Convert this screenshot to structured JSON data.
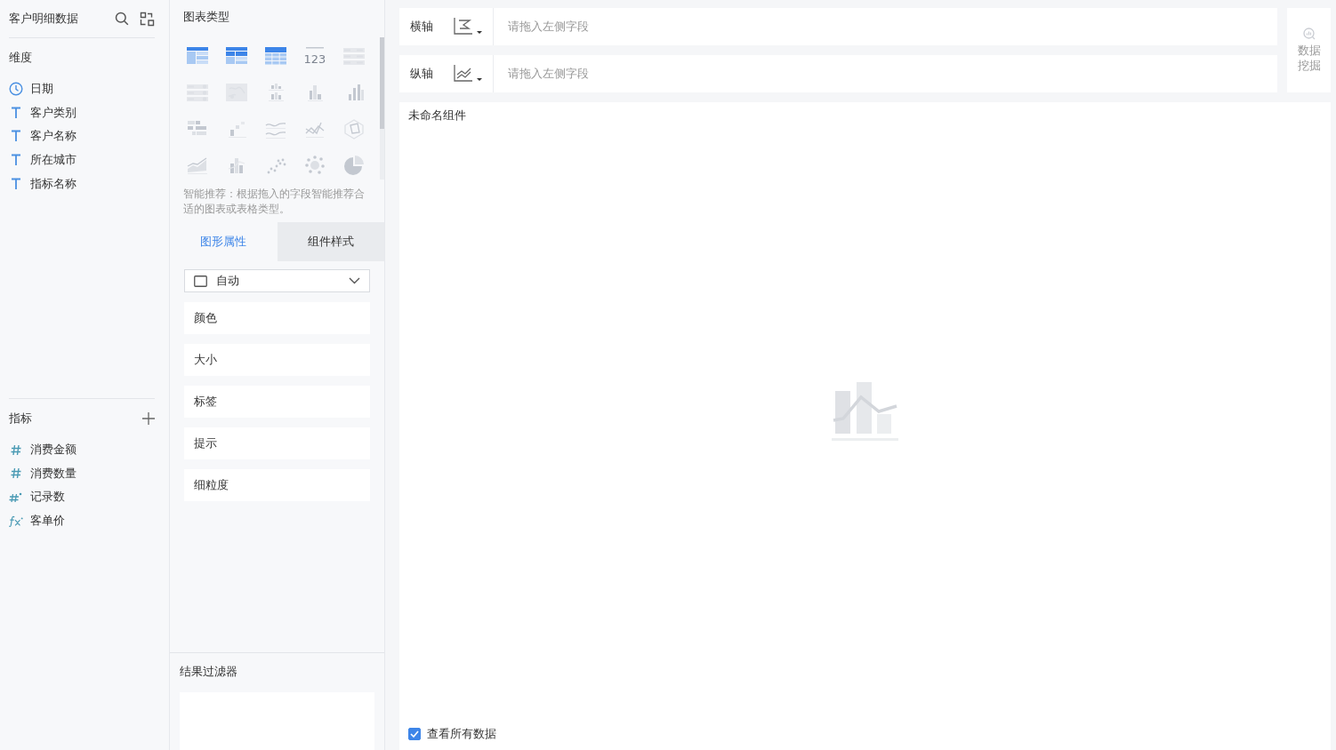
{
  "dataset": {
    "title": "客户明细数据"
  },
  "dimensions": {
    "title": "维度",
    "fields": [
      {
        "name": "日期",
        "kind": "date"
      },
      {
        "name": "客户类别",
        "kind": "text"
      },
      {
        "name": "客户名称",
        "kind": "text"
      },
      {
        "name": "所在城市",
        "kind": "text"
      },
      {
        "name": "指标名称",
        "kind": "text"
      }
    ]
  },
  "measures": {
    "title": "指标",
    "fields": [
      {
        "name": "消费金额",
        "kind": "number"
      },
      {
        "name": "消费数量",
        "kind": "number"
      },
      {
        "name": "记录数",
        "kind": "count"
      },
      {
        "name": "客单价",
        "kind": "formula"
      }
    ]
  },
  "chart_types": {
    "title": "图表类型",
    "items": [
      {
        "kind": "cross-table",
        "enabled": true
      },
      {
        "kind": "group-table",
        "enabled": true
      },
      {
        "kind": "detail-table",
        "enabled": true
      },
      {
        "kind": "number",
        "enabled": false,
        "label": "123"
      },
      {
        "kind": "kpi-list",
        "enabled": false
      },
      {
        "kind": "kpi-card",
        "enabled": false
      },
      {
        "kind": "map",
        "enabled": false
      },
      {
        "kind": "grouped-bar",
        "enabled": false
      },
      {
        "kind": "bar",
        "enabled": false
      },
      {
        "kind": "column",
        "enabled": false
      },
      {
        "kind": "horizontal-bar",
        "enabled": false
      },
      {
        "kind": "step",
        "enabled": false
      },
      {
        "kind": "multi-line",
        "enabled": false
      },
      {
        "kind": "line",
        "enabled": false
      },
      {
        "kind": "radar",
        "enabled": false
      },
      {
        "kind": "area",
        "enabled": false
      },
      {
        "kind": "bar-line",
        "enabled": false
      },
      {
        "kind": "scatter",
        "enabled": false
      },
      {
        "kind": "bubble",
        "enabled": false
      },
      {
        "kind": "pie",
        "enabled": false
      }
    ],
    "hint": "智能推荐：根据拖入的字段智能推荐合适的图表或表格类型。"
  },
  "property_tabs": [
    {
      "label": "图形属性",
      "selected": true
    },
    {
      "label": "组件样式",
      "selected": false
    }
  ],
  "mark_type": {
    "value": "自动"
  },
  "attributes": [
    "颜色",
    "大小",
    "标签",
    "提示",
    "细粒度"
  ],
  "result_filter": {
    "title": "结果过滤器"
  },
  "axes": [
    {
      "label": "横轴",
      "kind": "horizontal",
      "placeholder": "请拖入左侧字段"
    },
    {
      "label": "纵轴",
      "kind": "vertical",
      "placeholder": "请拖入左侧字段"
    }
  ],
  "data_mining": {
    "label": "数据挖掘"
  },
  "widget": {
    "title": "未命名组件",
    "show_all_data": {
      "label": "查看所有数据",
      "checked": true
    }
  }
}
